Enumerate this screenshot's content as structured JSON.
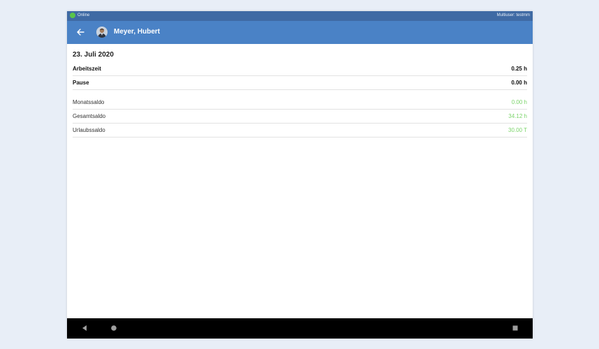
{
  "status_bar": {
    "connection": "Online",
    "user": "Multiuser: testmm"
  },
  "app_bar": {
    "title": "Meyer, Hubert",
    "back_icon": "arrow-left-icon"
  },
  "date": "23. Juli 2020",
  "summary_rows": [
    {
      "label": "Arbeitszeit",
      "value": "0.25 h"
    },
    {
      "label": "Pause",
      "value": "0.00 h"
    }
  ],
  "balance_rows": [
    {
      "label": "Monatssaldo",
      "value": "0.00 h"
    },
    {
      "label": "Gesamtsaldo",
      "value": "34.12 h"
    },
    {
      "label": "Urlaubssaldo",
      "value": "30.00 T"
    }
  ],
  "nav": {
    "back": "triangle-back-icon",
    "home": "circle-home-icon",
    "recents": "square-recents-icon"
  },
  "colors": {
    "status_bar": "#3f6aa4",
    "app_bar": "#4a82c6",
    "online_dot": "#59c44a",
    "balance_value": "#7bd46a"
  }
}
